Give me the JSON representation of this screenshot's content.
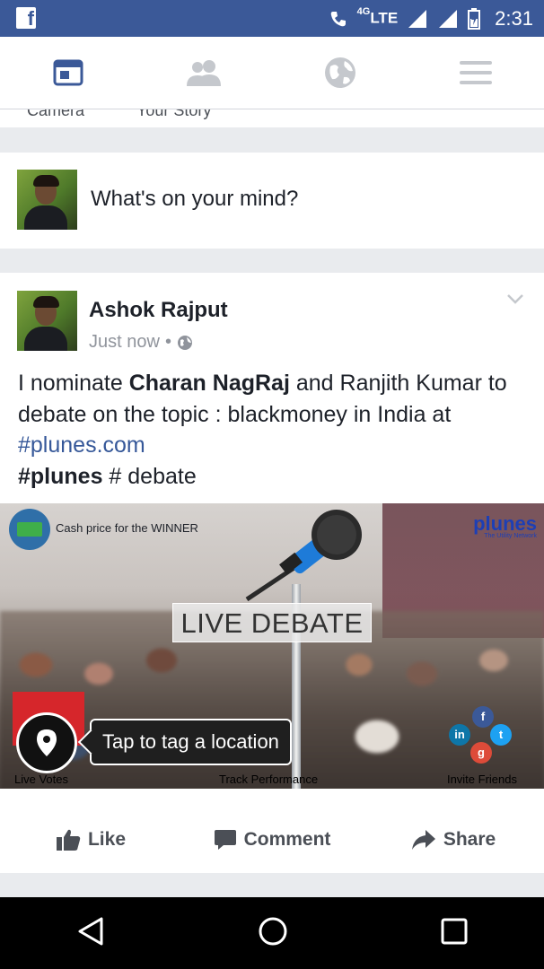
{
  "status_bar": {
    "network_label": "LTE",
    "network_superscript": "4G",
    "time": "2:31"
  },
  "nav": {
    "tabs": [
      {
        "icon": "news-feed-icon",
        "active": true
      },
      {
        "icon": "friends-icon",
        "active": false
      },
      {
        "icon": "globe-icon",
        "active": false
      },
      {
        "icon": "menu-icon",
        "active": false
      }
    ],
    "active_color": "#3b5998",
    "inactive_color": "#c5c8cd"
  },
  "stories": {
    "items": [
      "Camera",
      "Your Story"
    ]
  },
  "composer": {
    "placeholder": "What's on your mind?"
  },
  "post": {
    "author": "Ashok Rajput",
    "time": "Just now",
    "separator": "•",
    "audience_icon": "globe-icon",
    "text": {
      "part1": "I nominate ",
      "nominee1": "Charan NagRaj",
      "part2": " and Ranjith Kumar to debate on the topic : blackmoney in India at ",
      "link_hash": "#",
      "link": "plunes.com",
      "hashtag": "#plunes",
      "part3": " # debate"
    },
    "image": {
      "cash_text": "Cash price for the WINNER",
      "brand": "plunes",
      "brand_tagline": "The Utility Network",
      "headline": "LIVE DEBATE",
      "caption_left": "Live Votes",
      "caption_center": "Track Performance",
      "caption_right": "Invite Friends",
      "location_prompt": "Tap to tag a location"
    },
    "actions": {
      "like": "Like",
      "comment": "Comment",
      "share": "Share"
    }
  },
  "colors": {
    "brand_blue": "#3b5998",
    "link_blue": "#365899",
    "text_dark": "#1d2129",
    "text_muted": "#90949c",
    "action_gray": "#4b4f56"
  }
}
